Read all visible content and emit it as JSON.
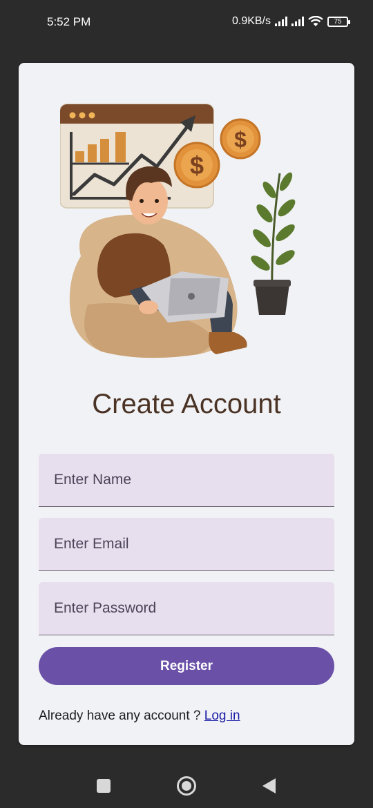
{
  "status_bar": {
    "time": "5:52 PM",
    "network_speed": "0.9KB/s",
    "battery_level": "75"
  },
  "register": {
    "title": "Create Account",
    "name_placeholder": "Enter Name",
    "email_placeholder": "Enter Email",
    "password_placeholder": "Enter Password",
    "button_label": "Register",
    "login_prompt": "Already have any account ? ",
    "login_link": "Log in"
  },
  "colors": {
    "accent": "#6a50a7",
    "field_background": "#e8dfee",
    "title": "#4a3325",
    "card_background": "#f1f2f5",
    "frame_background": "#2b2b2b"
  },
  "icons": {
    "hero": "man-on-beanbag-with-laptop-illustration",
    "status": [
      "signal-icon",
      "signal-icon",
      "wifi-icon",
      "battery-icon"
    ],
    "nav": [
      "recents-square-icon",
      "home-circle-icon",
      "back-triangle-icon"
    ]
  }
}
